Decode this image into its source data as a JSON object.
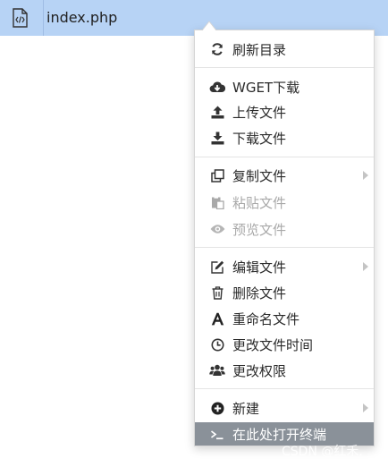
{
  "file": {
    "name": "index.php",
    "icon": "php-file-icon"
  },
  "menu": {
    "items": [
      {
        "label": "刷新目录",
        "icon": "refresh-icon"
      },
      {
        "label": "WGET下载",
        "icon": "cloud-download-icon"
      },
      {
        "label": "上传文件",
        "icon": "upload-icon"
      },
      {
        "label": "下载文件",
        "icon": "download-icon"
      },
      {
        "label": "复制文件",
        "icon": "copy-icon",
        "has_submenu": true
      },
      {
        "label": "粘贴文件",
        "icon": "paste-icon",
        "disabled": true
      },
      {
        "label": "预览文件",
        "icon": "eye-icon",
        "disabled": true
      },
      {
        "label": "编辑文件",
        "icon": "edit-icon",
        "has_submenu": true
      },
      {
        "label": "删除文件",
        "icon": "trash-icon"
      },
      {
        "label": "重命名文件",
        "icon": "font-icon"
      },
      {
        "label": "更改文件时间",
        "icon": "clock-icon"
      },
      {
        "label": "更改权限",
        "icon": "users-icon"
      },
      {
        "label": "新建",
        "icon": "plus-circle-icon",
        "has_submenu": true
      },
      {
        "label": "在此处打开终端",
        "icon": "terminal-icon",
        "active": true
      }
    ]
  },
  "watermark": "CSDN @红禾.",
  "colors": {
    "selection": "#b7d3f5",
    "menu_active": "#8a9199",
    "disabled_text": "#a9a9a9",
    "icon": "#333333"
  }
}
